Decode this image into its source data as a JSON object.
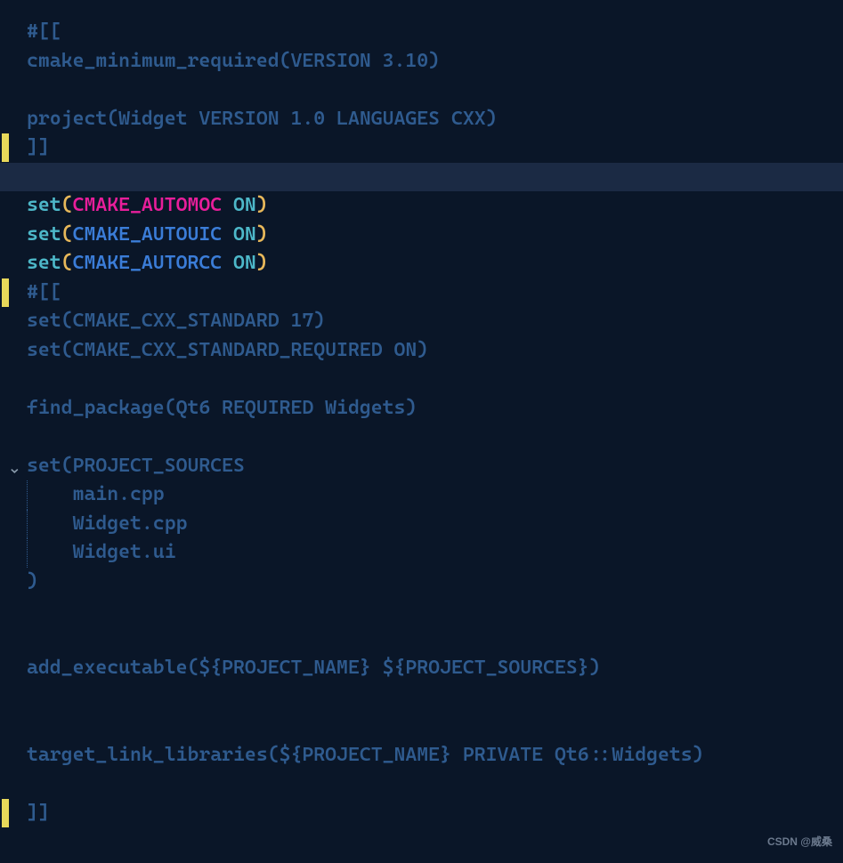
{
  "code": {
    "l1": {
      "a": "#[["
    },
    "l2": {
      "a": "cmake_minimum_required(VERSION 3.10)"
    },
    "l3": {
      "a": ""
    },
    "l4": {
      "a": "project(Widget VERSION 1.0 LANGUAGES CXX)"
    },
    "l5": {
      "a": "]]"
    },
    "l6": {
      "a": ""
    },
    "l7": {
      "kw": "set",
      "op": "(",
      "var": "CMAKE_AUTOMOC",
      "sp": " ",
      "val": "ON",
      "cp": ")"
    },
    "l8": {
      "kw": "set",
      "op": "(",
      "var": "CMAKE_AUTOUIC",
      "sp": " ",
      "val": "ON",
      "cp": ")"
    },
    "l9": {
      "kw": "set",
      "op": "(",
      "var": "CMAKE_AUTORCC",
      "sp": " ",
      "val": "ON",
      "cp": ")"
    },
    "l10": {
      "a": "#[["
    },
    "l11": {
      "a": "set(CMAKE_CXX_STANDARD 17)"
    },
    "l12": {
      "a": "set(CMAKE_CXX_STANDARD_REQUIRED ON)"
    },
    "l13": {
      "a": ""
    },
    "l14": {
      "a": "find_package(Qt6 REQUIRED Widgets)"
    },
    "l15": {
      "a": ""
    },
    "l16": {
      "a": "set(PROJECT_SOURCES"
    },
    "l17": {
      "a": "    main.cpp"
    },
    "l18": {
      "a": "    Widget.cpp"
    },
    "l19": {
      "a": "    Widget.ui"
    },
    "l20": {
      "a": ")"
    },
    "l21": {
      "a": ""
    },
    "l22": {
      "a": ""
    },
    "l23": {
      "a": "add_executable(${PROJECT_NAME} ${PROJECT_SOURCES})"
    },
    "l24": {
      "a": ""
    },
    "l25": {
      "a": ""
    },
    "l26": {
      "a": "target_link_libraries(${PROJECT_NAME} PRIVATE Qt6::Widgets)"
    },
    "l27": {
      "a": ""
    },
    "l28": {
      "a": "]]"
    }
  },
  "watermark": "CSDN @威桑",
  "fold_chevron": "⌄"
}
